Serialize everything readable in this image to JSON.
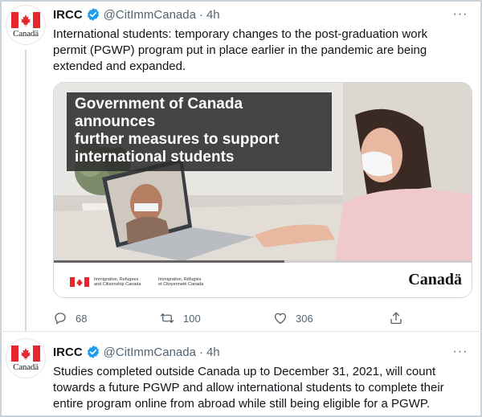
{
  "tweets": [
    {
      "author": {
        "name": "IRCC",
        "handle": "@CitImmCanada",
        "avatar_wordmark": "Canadä",
        "verified": true
      },
      "time": "4h",
      "text_lines": [
        "International students: temporary changes to the post-graduation work",
        "permit (PGWP) program put in place earlier in the pandemic are being",
        "extended and expanded."
      ],
      "media": {
        "headline_lines": [
          "Government of Canada announces",
          "further measures to support",
          "international students"
        ],
        "video_progress_percent": 55,
        "dept_en": [
          "Immigration, Refugees",
          "and Citizenship Canada"
        ],
        "dept_fr": [
          "Immigration, Réfugiés",
          "et Citoyenneté Canada"
        ],
        "wordmark": "Canadä"
      },
      "actions": {
        "replies": "68",
        "retweets": "100",
        "likes": "306"
      }
    },
    {
      "author": {
        "name": "IRCC",
        "handle": "@CitImmCanada",
        "avatar_wordmark": "Canadä",
        "verified": true
      },
      "time": "4h",
      "text_lines": [
        "Studies completed outside Canada up to December 31, 2021, will count",
        "towards a future PGWP and allow international students to complete their",
        "entire program online from abroad while still being eligible for a PGWP."
      ]
    }
  ],
  "colors": {
    "verified": "#1d9bf0",
    "flag_red": "#e5272d",
    "secondary_text": "#536471"
  },
  "icons": [
    "canada-flag-icon",
    "verified-badge-icon",
    "more-icon",
    "reply-icon",
    "retweet-icon",
    "like-icon",
    "share-icon"
  ]
}
